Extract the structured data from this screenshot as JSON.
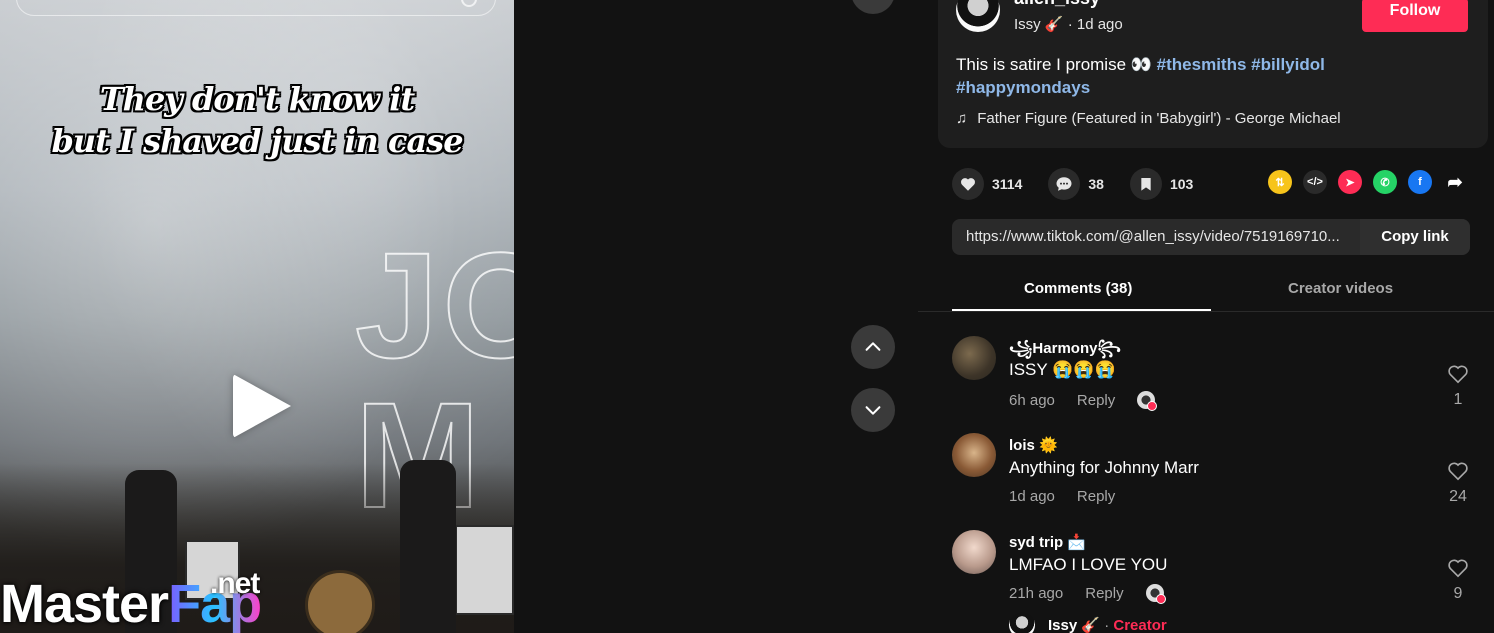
{
  "video": {
    "caption_line1": "They don't know it",
    "caption_line2": "but I shaved just in case",
    "stage_text": "JO\nM",
    "watermark_main": "Master",
    "watermark_fap": "Fap",
    "watermark_net": ".net"
  },
  "post": {
    "username": "allen_issy",
    "display_name": "Issy 🎸",
    "time": "· 1d ago",
    "follow_label": "Follow",
    "description": "This is satire I promise 👀",
    "hashtags": [
      "#thesmiths",
      "#billyidol",
      "#happymondays"
    ],
    "music_icon": "♫",
    "music": "Father Figure (Featured in 'Babygirl') - George Michael"
  },
  "actions": {
    "likes": "3114",
    "comments": "38",
    "saves": "103"
  },
  "share": {
    "link": "https://www.tiktok.com/@allen_issy/video/7519169710...",
    "copy_label": "Copy link"
  },
  "tabs": {
    "comments": "Comments (38)",
    "creator": "Creator videos"
  },
  "comments": [
    {
      "name": "꧁Harmony꧂",
      "text": "ISSY 😭😭😭",
      "time": "6h ago",
      "reply": "Reply",
      "likes": "1"
    },
    {
      "name": "lois 🌞",
      "text": "Anything for Johnny Marr",
      "time": "1d ago",
      "reply": "Reply",
      "likes": "24"
    },
    {
      "name": "syd trip 📩",
      "text": "LMFAO I LOVE YOU",
      "time": "21h ago",
      "reply": "Reply",
      "likes": "9"
    }
  ],
  "reply_preview": {
    "name": "Issy 🎸",
    "sep": "·",
    "tag": "Creator"
  },
  "colors": {
    "accent": "#fe2c55",
    "hashtag": "#8fb8e8",
    "panel_bg": "#121212",
    "card_bg": "#1e1e1e"
  }
}
